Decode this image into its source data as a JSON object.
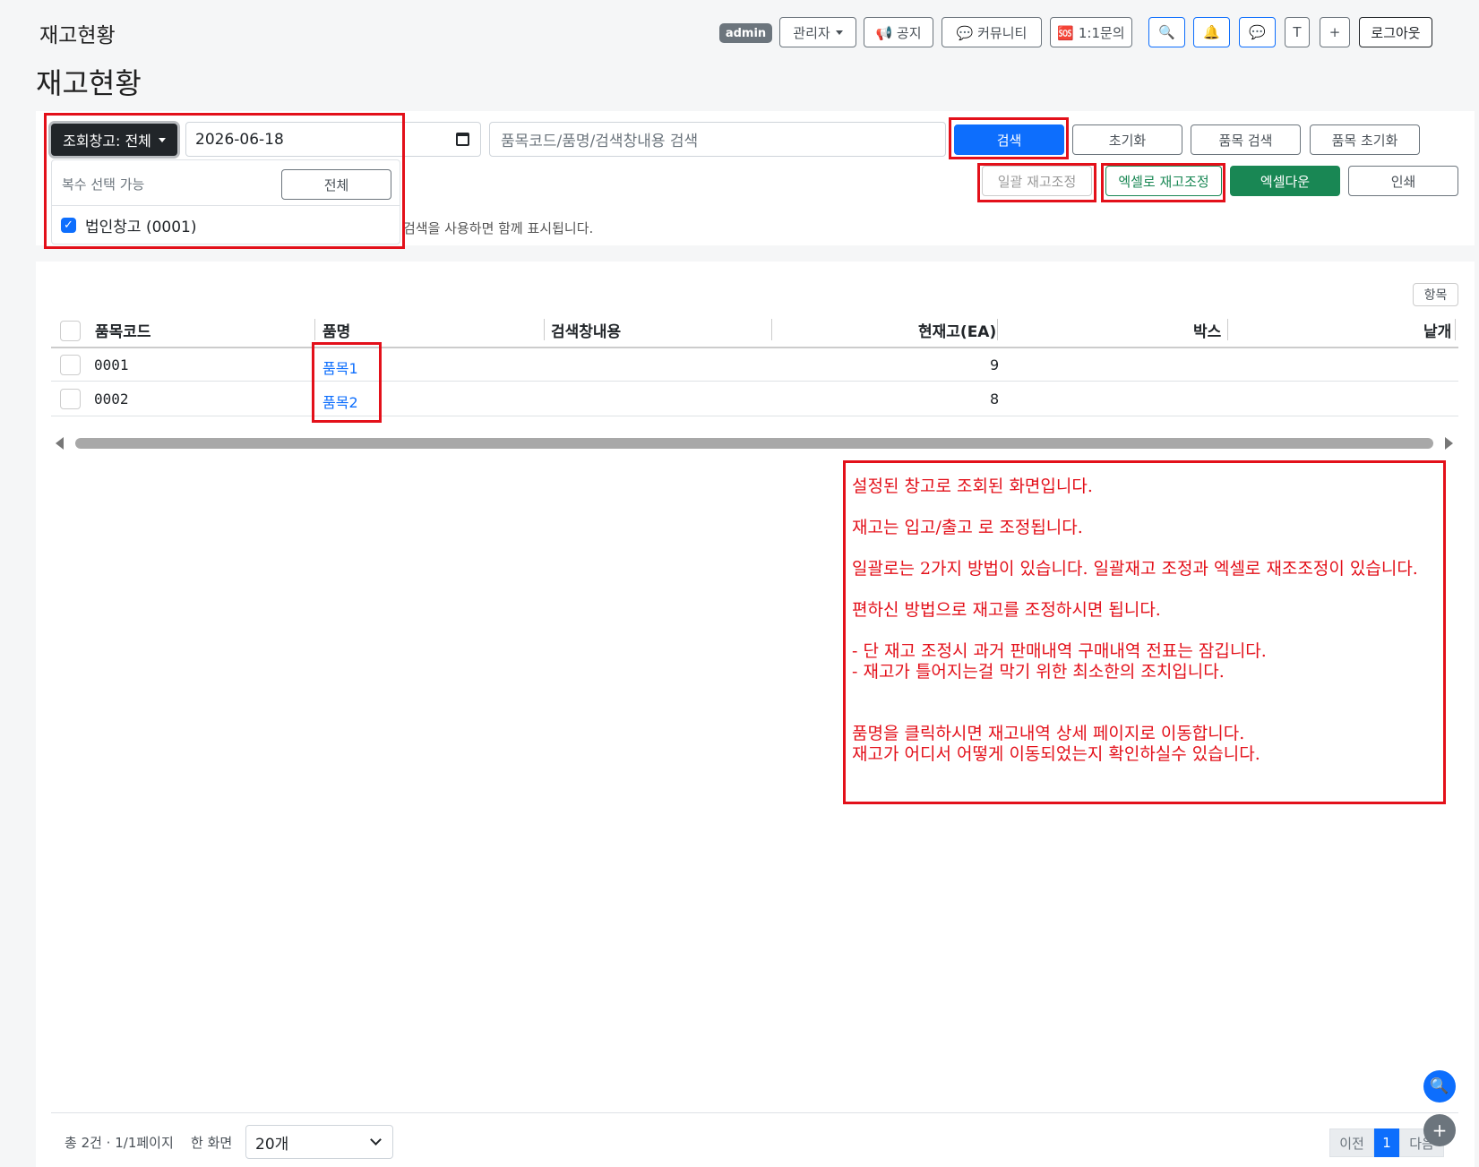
{
  "header": {
    "app_title": "재고현황",
    "admin_badge": "admin",
    "role_dropdown": "관리자",
    "notice_label": "📢 공지",
    "community_label": "💬 커뮤니티",
    "inquiry_label": "🆘 1:1문의",
    "search_icon": "🔍",
    "bell_icon": "🔔",
    "chat_icon": "💬",
    "t_label": "T",
    "plus_label": "+",
    "logout_label": "로그아웃"
  },
  "page": {
    "title": "재고현황"
  },
  "filters": {
    "warehouse_label": "조회창고: 전체",
    "date_value": "2026-06-18",
    "search_placeholder": "품목코드/품명/검색창내용 검색",
    "search_btn": "검색",
    "reset_btn": "초기화",
    "item_search_btn": "품목 검색",
    "item_reset_btn": "품목 초기화",
    "bulk_adjust_btn": "일괄 재고조정",
    "excel_adjust_btn": "엑셀로 재고조정",
    "excel_download_btn": "엑셀다운",
    "print_btn": "인쇄",
    "hint_text": "검색을 사용하면 함께 표시됩니다.",
    "dropdown": {
      "multi_select_label": "복수 선택 가능",
      "all_btn": "전체",
      "options": [
        {
          "label": "법인창고 (0001)",
          "checked": true
        }
      ]
    }
  },
  "table": {
    "columns_btn": "항목",
    "headers": [
      "품목코드",
      "품명",
      "검색창내용",
      "현재고(EA)",
      "박스",
      "낱개"
    ],
    "rows": [
      {
        "code": "0001",
        "name": "품목1",
        "search_text": "",
        "stock": "9",
        "box": "",
        "unit": ""
      },
      {
        "code": "0002",
        "name": "품목2",
        "search_text": "",
        "stock": "8",
        "box": "",
        "unit": ""
      }
    ]
  },
  "annotation": {
    "text": "설정된 창고로 조회된 화면입니다.\n\n재고는 입고/출고 로 조정됩니다.\n\n일괄로는 2가지 방법이 있습니다. 일괄재고 조정과 엑셀로 재조조정이 있습니다.\n\n편하신 방법으로 재고를 조정하시면 됩니다.\n\n- 단 재고 조정시 과거 판매내역 구매내역 전표는 잠깁니다.\n- 재고가 틀어지는걸 막기 위한 최소한의 조치입니다.\n\n\n품명을 클릭하시면 재고내역 상세 페이지로 이동합니다.\n재고가 어디서 어떻게 이동되었는지 확인하실수 있습니다."
  },
  "footer": {
    "summary": "총 2건 · 1/1페이지",
    "per_page_label": "한 화면",
    "per_page_value": "20개",
    "prev_btn": "이전",
    "page_1": "1",
    "next_btn": "다음"
  },
  "fab": {
    "search_icon": "🔍",
    "plus_icon": "+"
  },
  "colors": {
    "primary": "#0d6efd",
    "success": "#198754",
    "annotation_red": "#e3101a",
    "dark": "#212529"
  }
}
